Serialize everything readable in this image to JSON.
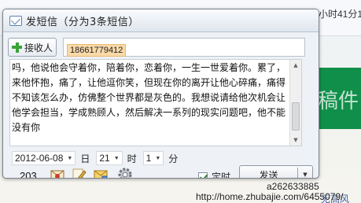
{
  "background": {
    "time_fragment": "小时41分1",
    "green_panel_text": "稿件",
    "blue_link_text": "无高风"
  },
  "dialog": {
    "title": "发短信（分为3条短信）",
    "recipient_button": "接收人",
    "recipients": [
      "18661779412"
    ],
    "message": "吗，他说他会守着你，陪着你，恋着你，一生一世爱着你。累了，来他怀抱，痛了，让他逗你笑，但现在你的离开让他心碎痛，痛得不知该怎么办，仿佛整个世界都是灰色的。我想说请给他次机会让他学会担当，学成熟顾人，然后解决一系列的现实问题吧，他不能没有你",
    "date_value": "2012-06-08",
    "day_label": "日",
    "hour_value": "21",
    "hour_label": "时",
    "minute_value": "1",
    "minute_label": "分",
    "char_count": "203",
    "timer_label": "定时",
    "timer_checked": true,
    "send_label": "发送"
  },
  "watermark": {
    "id": "a262633885",
    "url": "http://home.zhubajie.com/6455079/"
  }
}
